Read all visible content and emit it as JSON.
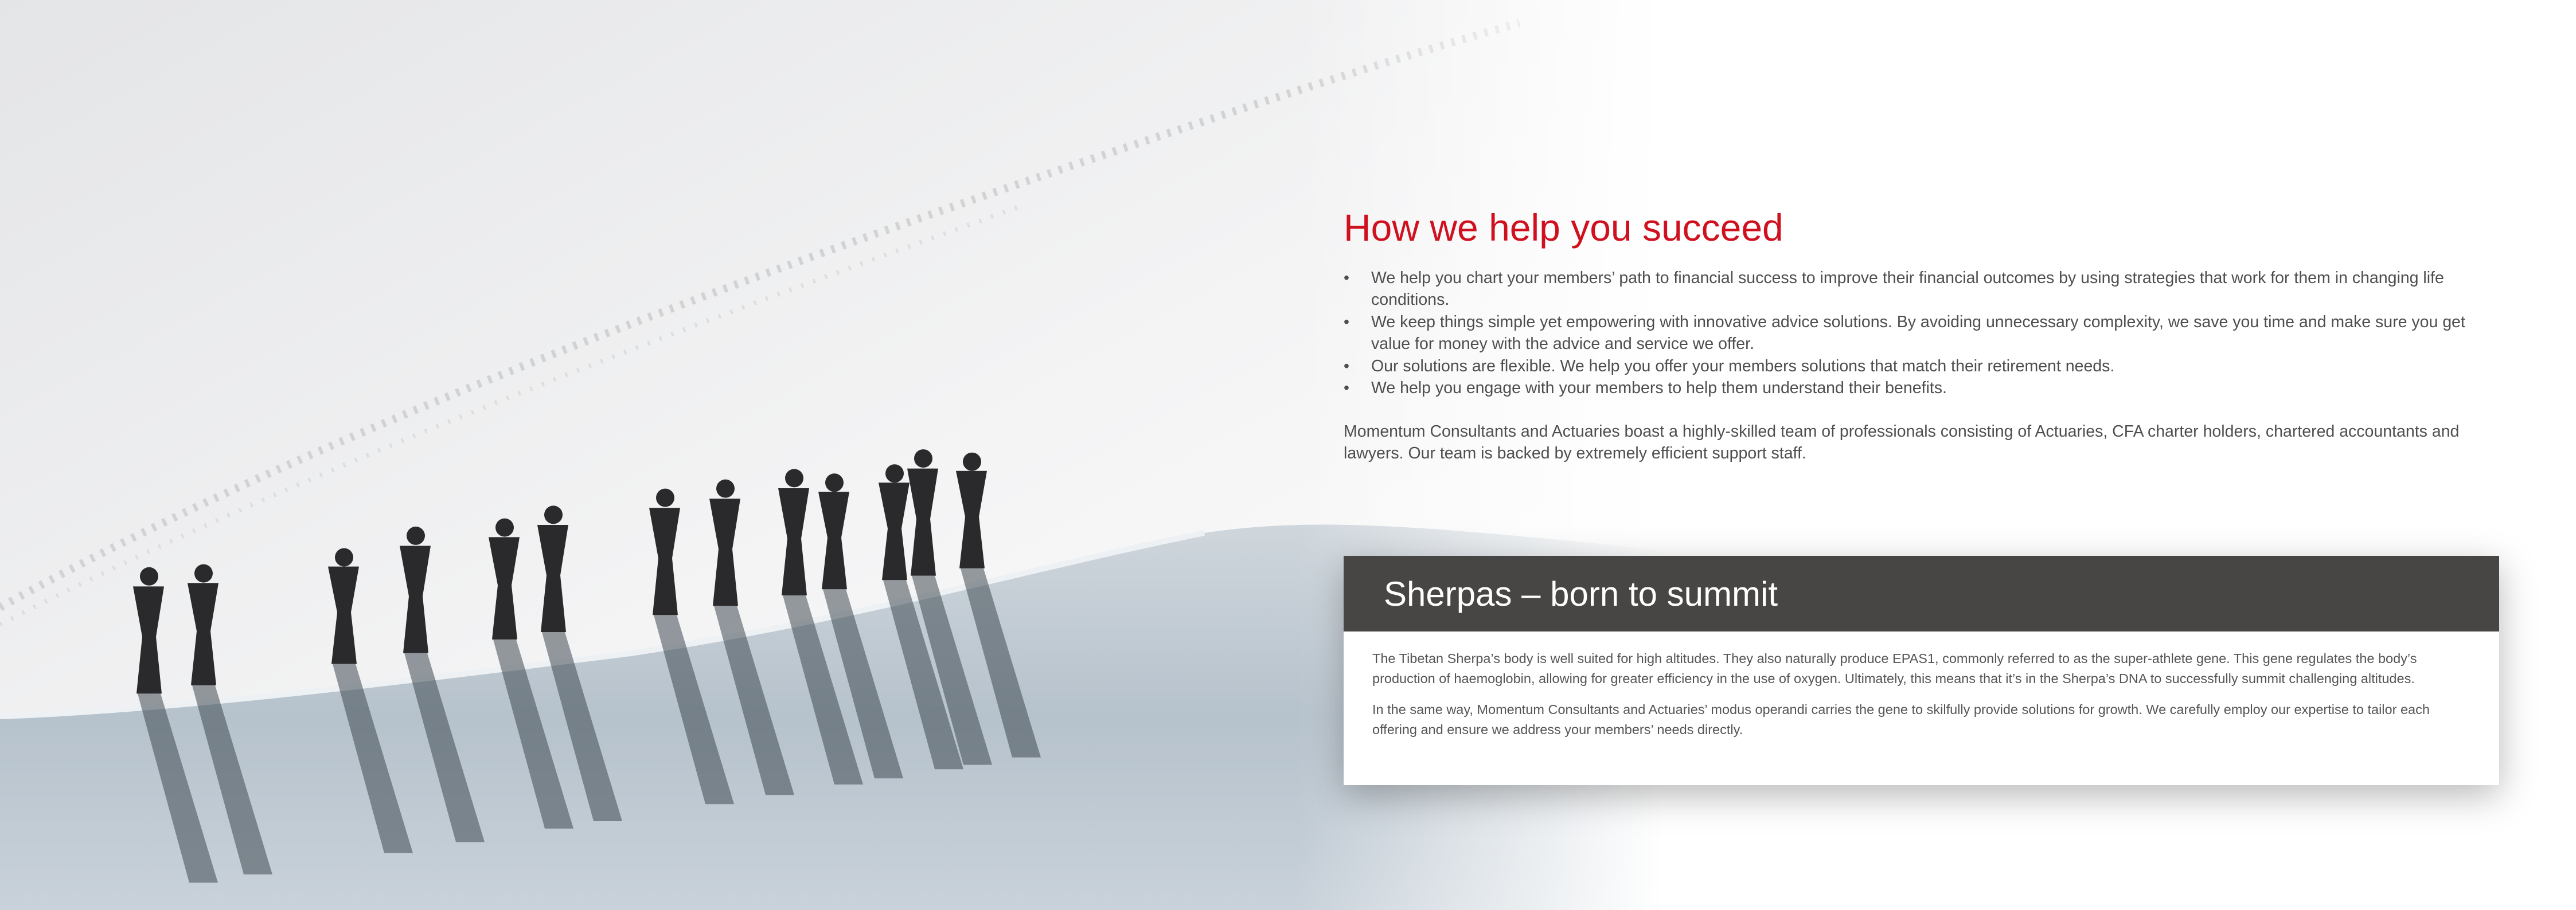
{
  "photo": {
    "description_icon": "mountaineers-on-snow-ridge-image"
  },
  "main": {
    "heading": "How we help you succeed",
    "bullets": [
      "We help you chart your members’ path to financial success to improve their financial outcomes by using strategies that work for them in changing life conditions.",
      "We keep things simple yet empowering with innovative advice solutions. By avoiding unnecessary complexity, we save you time and make sure you get value for money with the advice and service we offer.",
      "Our solutions are flexible. We help you offer your members solutions that match their retirement needs.",
      "We help you engage with your members to help them understand their benefits."
    ],
    "bullet_symbol": "•",
    "intro": "Momentum Consultants and Actuaries boast a highly-skilled team of professionals consisting of Actuaries, CFA charter holders, chartered accountants and lawyers. Our team is backed by extremely efficient support staff."
  },
  "card": {
    "title": "Sherpas – born to summit",
    "paragraphs": [
      "The Tibetan Sherpa’s body is well suited for high altitudes. They also naturally produce EPAS1, commonly referred to as the super-athlete gene. This gene regulates the body’s production of haemoglobin, allowing for greater efficiency in the use of oxygen. Ultimately, this means that it’s in the Sherpa’s DNA to successfully summit challenging altitudes.",
      "In the same way, Momentum Consultants and Actuaries’ modus operandi carries the gene to skilfully provide solutions for growth. We carefully employ our expertise to tailor each offering and ensure we address your members’ needs directly."
    ]
  },
  "colors": {
    "accent_red": "#d0101e",
    "card_header": "#474644",
    "body_text": "#4e4e4e"
  }
}
